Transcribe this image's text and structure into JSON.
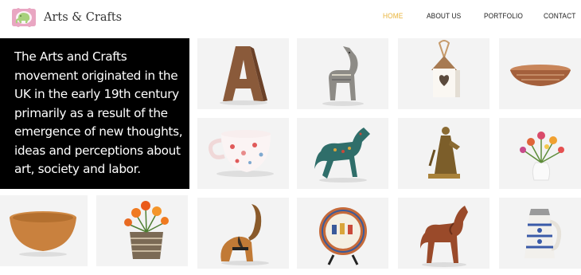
{
  "brand": {
    "name": "Arts & Crafts",
    "logo_icon": "elephant-icon",
    "logo_colors": {
      "badge": "#e9a6c2",
      "elephant": "#a8d17c"
    }
  },
  "nav": {
    "items": [
      {
        "label": "HOME",
        "active": true
      },
      {
        "label": "ABOUT US",
        "active": false
      },
      {
        "label": "PORTFOLIO",
        "active": false
      },
      {
        "label": "CONTACT",
        "active": false
      }
    ],
    "active_color": "#e8b33a"
  },
  "intro": {
    "text": "The Arts and Crafts movement originated in the UK in the early 19th century primarily as a result of the emergence of new thoughts, ideas and perceptions about art, society and labor."
  },
  "gallery": {
    "items": [
      {
        "name": "wooden-letter-a"
      },
      {
        "name": "painted-wooden-horse"
      },
      {
        "name": "birdhouse-ornament"
      },
      {
        "name": "woven-bowl"
      },
      {
        "name": "floral-teacup"
      },
      {
        "name": "cloisonne-horse"
      },
      {
        "name": "bronze-figurine"
      },
      {
        "name": "flowers-white-vase"
      },
      {
        "name": "wooden-salad-bowl"
      },
      {
        "name": "flower-basket"
      },
      {
        "name": "wooden-elephant"
      },
      {
        "name": "decorative-plate"
      },
      {
        "name": "carved-horse"
      },
      {
        "name": "ceramic-stein"
      }
    ]
  }
}
